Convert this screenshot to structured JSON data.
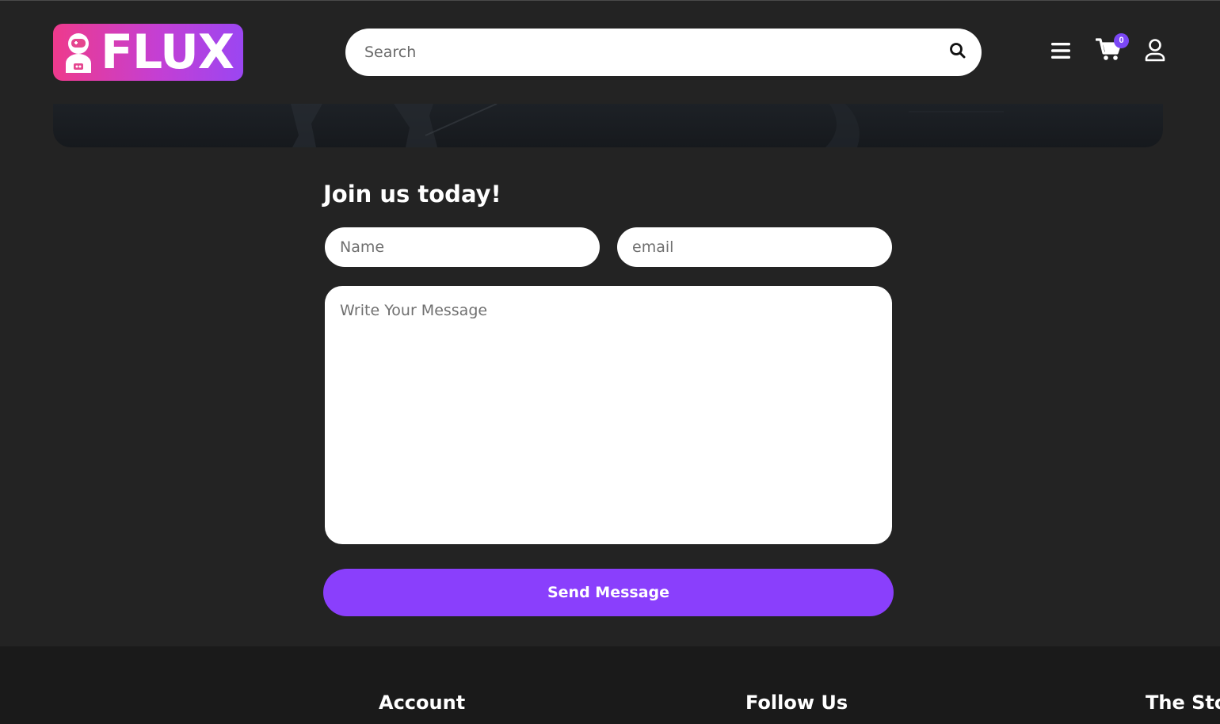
{
  "header": {
    "logo_text": "FLUX",
    "search_placeholder": "Search",
    "cart_count": "0",
    "icons": [
      "search-icon",
      "menu-icon",
      "cart-icon",
      "user-icon"
    ]
  },
  "form": {
    "title": "Join us today!",
    "name_placeholder": "Name",
    "email_placeholder": "email",
    "message_placeholder": "Write Your Message",
    "send_label": "Send Message"
  },
  "footer": {
    "headings": [
      "Account",
      "Follow Us",
      "The Sto"
    ]
  },
  "colors": {
    "background": "#232323",
    "footer": "#1a1a1a",
    "accent": "#8a3ffc",
    "logo_gradient_start": "#ee3a8c",
    "logo_gradient_end": "#9b46f2"
  }
}
